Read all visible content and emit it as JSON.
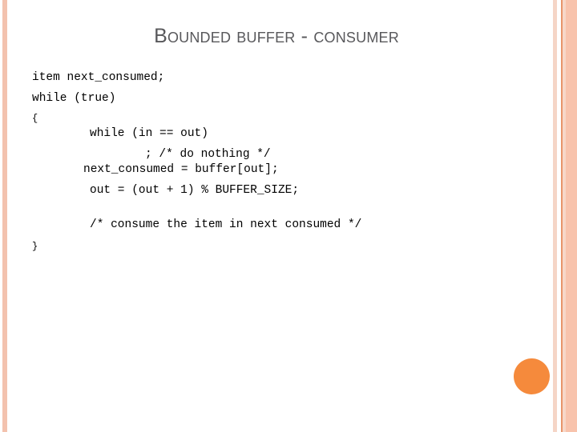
{
  "slide": {
    "title": "Bounded buffer - consumer",
    "title_color": "#58585B",
    "background_color": "#FFFFFF"
  },
  "decor": {
    "left_band_color": "#F3C2AE",
    "right_band_1_color": "#F5D5C6",
    "right_band_2_color": "#E8956A",
    "right_band_3_color": "#F7D7C8",
    "right_band_4_color": "#F8C3AC",
    "accent_dot_color": "#F58A3C"
  },
  "code": {
    "line1": "item next_consumed;",
    "line2": "while (true)",
    "line3": "{",
    "line4": "while (in == out)",
    "line5": "; /* do nothing */",
    "line6": "next_consumed = buffer[out];",
    "line7": "out = (out + 1) % BUFFER_SIZE;",
    "line8": "/* consume the item in next consumed */",
    "line9": "}"
  }
}
